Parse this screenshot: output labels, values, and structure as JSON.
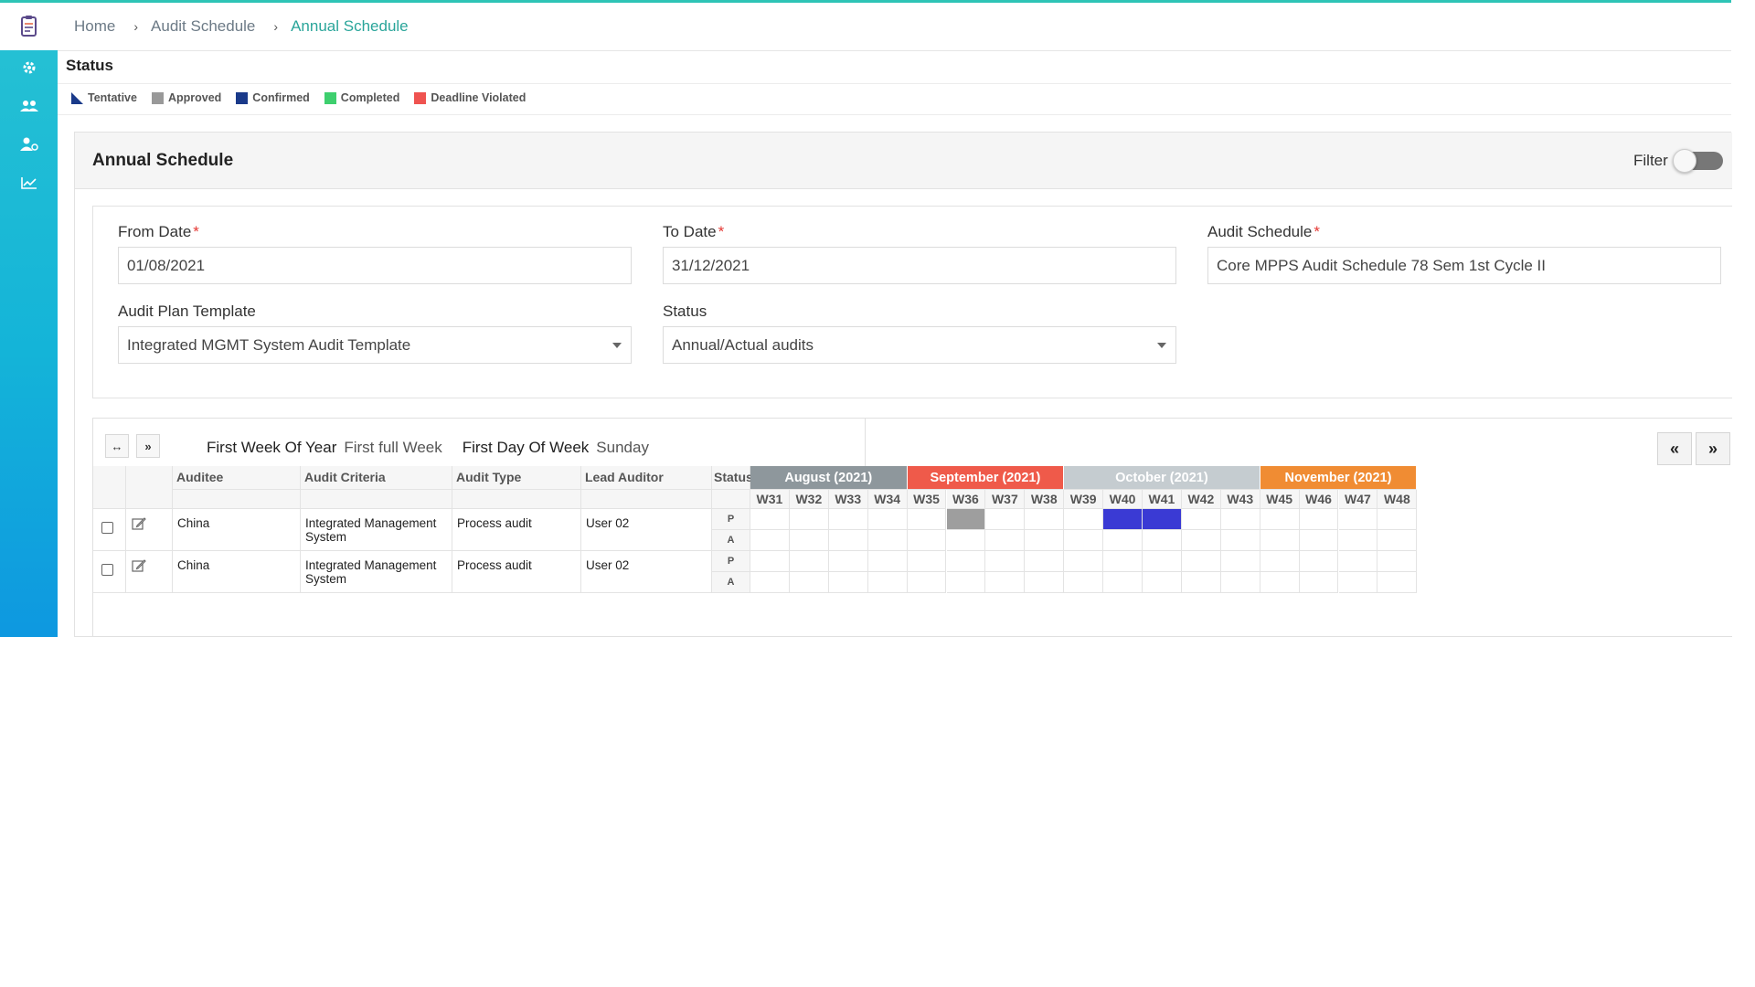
{
  "breadcrumb": {
    "home": "Home",
    "audit_schedule": "Audit Schedule",
    "current": "Annual Schedule"
  },
  "status_section": {
    "title": "Status",
    "legend": [
      {
        "label": "Tentative",
        "color": "#1a3a8a"
      },
      {
        "label": "Approved",
        "color": "#999999"
      },
      {
        "label": "Confirmed",
        "color": "#1a3a8a"
      },
      {
        "label": "Completed",
        "color": "#3ecf6e"
      },
      {
        "label": "Deadline Violated",
        "color": "#ef5350"
      }
    ]
  },
  "panel": {
    "title": "Annual Schedule",
    "filter_label": "Filter",
    "filter_on": false
  },
  "form": {
    "from_date": {
      "label": "From Date",
      "value": "01/08/2021"
    },
    "to_date": {
      "label": "To Date",
      "value": "31/12/2021"
    },
    "audit_schedule": {
      "label": "Audit Schedule",
      "value": "Core MPPS Audit Schedule 78 Sem 1st Cycle II"
    },
    "audit_plan_template": {
      "label": "Audit Plan Template",
      "value": "Integrated MGMT System Audit Template"
    },
    "status": {
      "label": "Status",
      "value": "Annual/Actual audits"
    }
  },
  "toolbar": {
    "expand_label": "↔",
    "next_label": "»",
    "first_week_key": "First Week Of Year",
    "first_week_value": "First full Week",
    "first_day_key": "First Day Of Week",
    "first_day_value": "Sunday",
    "prev_page": "«",
    "next_page": "»"
  },
  "table": {
    "columns": [
      "Auditee",
      "Audit Criteria",
      "Audit Type",
      "Lead Auditor"
    ],
    "status_header": "Status",
    "rows": [
      {
        "auditee": "China",
        "criteria": "Integrated Management System",
        "type": "Process audit",
        "lead": "User 02",
        "p": "P",
        "a": "A"
      },
      {
        "auditee": "China",
        "criteria": "Integrated Management System",
        "type": "Process audit",
        "lead": "User 02",
        "p": "P",
        "a": "A"
      }
    ]
  },
  "calendar": {
    "months": [
      {
        "label": "August (2021)",
        "weeks": 4,
        "color": "#8e979c"
      },
      {
        "label": "September (2021)",
        "weeks": 4,
        "color": "#ef5a4a"
      },
      {
        "label": "October (2021)",
        "weeks": 5,
        "color": "#c5ccd0"
      },
      {
        "label": "November (2021)",
        "weeks": 4,
        "color": "#f08c33"
      }
    ],
    "weeks": [
      "W31",
      "W32",
      "W33",
      "W34",
      "W35",
      "W36",
      "W37",
      "W38",
      "W39",
      "W40",
      "W41",
      "W42",
      "W43",
      "W45",
      "W46",
      "W47",
      "W48"
    ],
    "marks": [
      {
        "row": 0,
        "line": "P",
        "week": "W36",
        "status": "Approved",
        "color": "#9e9e9e"
      },
      {
        "row": 0,
        "line": "P",
        "week": "W40",
        "status": "Confirmed",
        "color": "#3a3ad4"
      },
      {
        "row": 0,
        "line": "P",
        "week": "W41",
        "status": "Confirmed",
        "color": "#3a3ad4"
      }
    ]
  }
}
